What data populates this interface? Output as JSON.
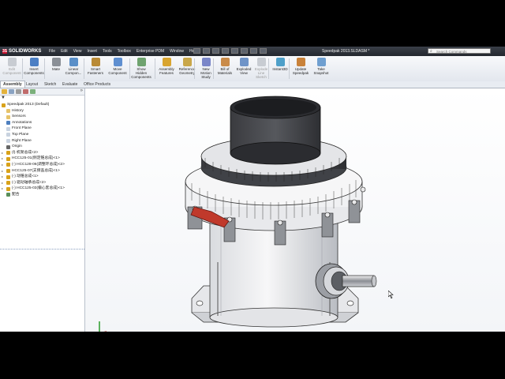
{
  "app": {
    "name": "SOLIDWORKS",
    "document_title": "Speedpak 2013.SLDASM *"
  },
  "menu": [
    "File",
    "Edit",
    "View",
    "Insert",
    "Tools",
    "Toolbox",
    "Enterprise PDM",
    "Window",
    "Help"
  ],
  "search": {
    "placeholder": "Search Commands"
  },
  "ribbon": [
    {
      "label": "Edit\nComponent",
      "icon": "edit-component-icon",
      "enabled": false
    },
    {
      "label": "Insert\nComponents",
      "icon": "insert-components-icon",
      "enabled": true
    },
    {
      "label": "Mate",
      "icon": "mate-icon",
      "enabled": true
    },
    {
      "label": "Linear\nCompon...",
      "icon": "linear-pattern-icon",
      "enabled": true
    },
    {
      "label": "Smart\nFasteners",
      "icon": "smart-fasteners-icon",
      "enabled": true
    },
    {
      "label": "Move\nComponent",
      "icon": "move-component-icon",
      "enabled": true
    },
    {
      "label": "Show\nHidden\nComponents",
      "icon": "show-hidden-icon",
      "enabled": true
    },
    {
      "label": "Assembly\nFeatures",
      "icon": "assembly-features-icon",
      "enabled": true
    },
    {
      "label": "Reference\nGeometry",
      "icon": "reference-geometry-icon",
      "enabled": true
    },
    {
      "label": "New\nMotion\nStudy",
      "icon": "motion-study-icon",
      "enabled": true
    },
    {
      "label": "Bill of\nMaterials",
      "icon": "bom-icon",
      "enabled": true
    },
    {
      "label": "Exploded\nView",
      "icon": "exploded-view-icon",
      "enabled": true
    },
    {
      "label": "Explode\nLine\nSketch",
      "icon": "explode-line-icon",
      "enabled": false
    },
    {
      "label": "Instant3D",
      "icon": "instant3d-icon",
      "enabled": true
    },
    {
      "label": "Update\nSpeedpak",
      "icon": "speedpak-icon",
      "enabled": true
    },
    {
      "label": "Take\nSnapshot",
      "icon": "snapshot-icon",
      "enabled": true
    }
  ],
  "command_tabs": [
    "Assembly",
    "Layout",
    "Sketch",
    "Evaluate",
    "Office Products"
  ],
  "active_tab": "Assembly",
  "tree": [
    {
      "label": "Speedpak 2013  (Default)",
      "level": 0,
      "icon": "assembly-icon",
      "color": "#d8a21b"
    },
    {
      "label": "History",
      "level": 1,
      "icon": "history-folder-icon",
      "color": "#e6c36a"
    },
    {
      "label": "Sensors",
      "level": 1,
      "icon": "sensors-folder-icon",
      "color": "#e6c36a"
    },
    {
      "label": "Annotations",
      "level": 1,
      "icon": "annotations-icon",
      "color": "#4e7fbf"
    },
    {
      "label": "Front Plane",
      "level": 1,
      "icon": "plane-icon",
      "color": "#c9d3e0"
    },
    {
      "label": "Top Plane",
      "level": 1,
      "icon": "plane-icon",
      "color": "#c9d3e0"
    },
    {
      "label": "Right Plane",
      "level": 1,
      "icon": "plane-icon",
      "color": "#c9d3e0"
    },
    {
      "label": "Origin",
      "level": 1,
      "icon": "origin-icon",
      "color": "#666666"
    },
    {
      "label": "(f) 机架总成<2>",
      "level": 1,
      "icon": "subassembly-icon",
      "color": "#d8a21b"
    },
    {
      "label": "HCC125-01(侧定锥总成)<1>",
      "level": 1,
      "icon": "subassembly-icon",
      "color": "#d8a21b"
    },
    {
      "label": "(-) HCC128-06(调整环总成)<2>",
      "level": 1,
      "icon": "subassembly-icon",
      "color": "#d8a21b"
    },
    {
      "label": "HCC125-07(支撑盖总成)<1>",
      "level": 1,
      "icon": "subassembly-icon",
      "color": "#d8a21b"
    },
    {
      "label": "(-) 动锥总成<1>",
      "level": 1,
      "icon": "subassembly-icon",
      "color": "#d8a21b"
    },
    {
      "label": "(-) 驱动轴承总成<2>",
      "level": 1,
      "icon": "subassembly-icon",
      "color": "#d8a21b"
    },
    {
      "label": "(-) HCC125-03(偏心套总成)<1>",
      "level": 1,
      "icon": "subassembly-icon",
      "color": "#d8a21b"
    },
    {
      "label": "配合",
      "level": 1,
      "icon": "mates-folder-icon",
      "color": "#5a8f5a"
    }
  ]
}
